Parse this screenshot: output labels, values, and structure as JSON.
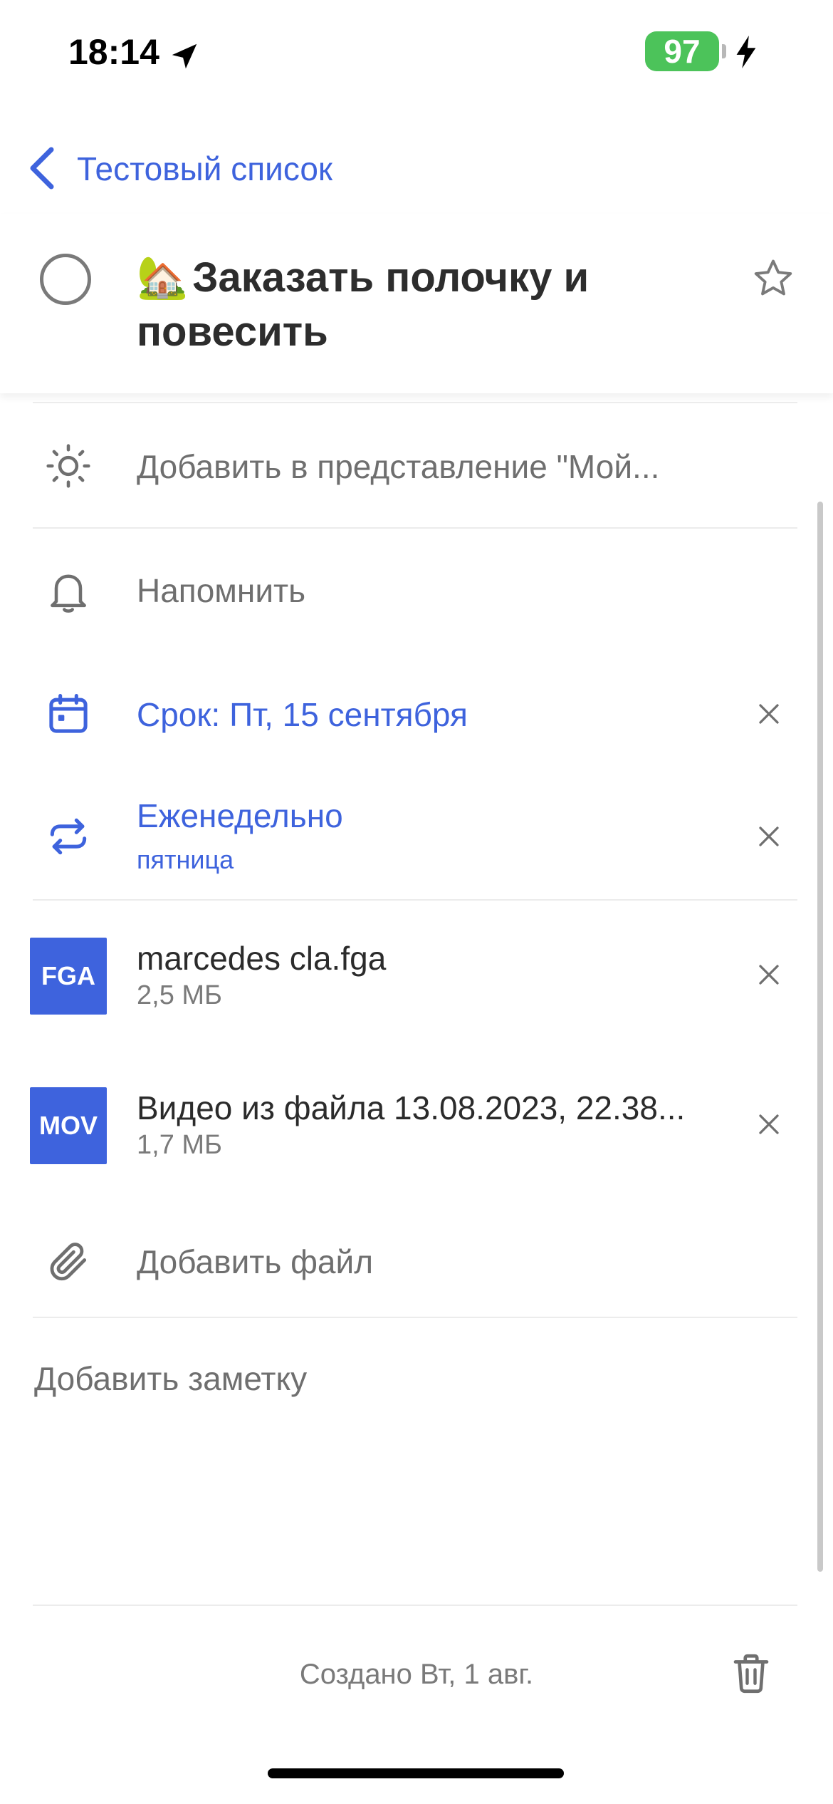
{
  "status_bar": {
    "time": "18:14",
    "battery": "97",
    "battery_color": "#4cc35a"
  },
  "nav": {
    "back_label": "Тестовый список"
  },
  "task": {
    "emoji": "🏡",
    "title": "Заказать полочку и повесить",
    "starred": false
  },
  "rows": {
    "my_day": "Добавить в представление \"Мой...",
    "remind": "Напомнить",
    "due": "Срок: Пт, 15 сентября",
    "repeat": "Еженедельно",
    "repeat_day": "пятница"
  },
  "files": [
    {
      "type": "FGA",
      "name": "marcedes cla.fga",
      "size": "2,5 МБ"
    },
    {
      "type": "MOV",
      "name": "Видео из файла 13.08.2023, 22.38...",
      "size": "1,7 МБ"
    }
  ],
  "add_file": "Добавить файл",
  "note_placeholder": "Добавить заметку",
  "footer": {
    "created": "Создано Вт, 1 авг."
  },
  "colors": {
    "accent": "#3e63dd",
    "muted_text": "#6f6f6f"
  }
}
